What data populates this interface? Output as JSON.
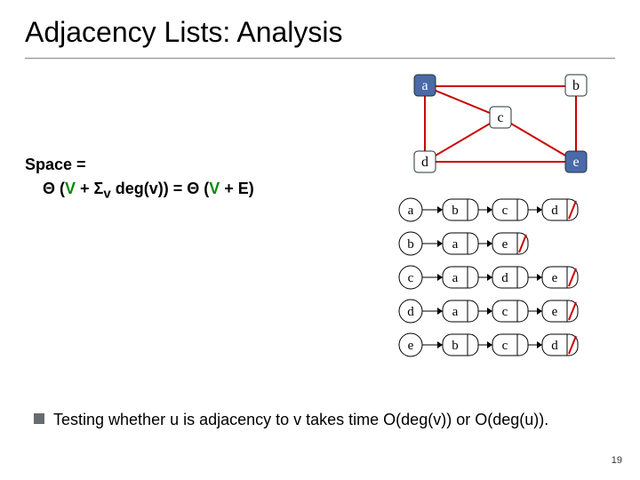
{
  "title": "Adjacency Lists: Analysis",
  "formula": {
    "line1": "Space =",
    "theta": "Θ",
    "open": " (",
    "V": "V",
    "plus": " + ",
    "sigma": "Σ",
    "sub_v": "v",
    "degv": " deg(v)) = ",
    "V2": "V",
    "plusE": " + E)"
  },
  "graph": {
    "nodes": [
      "a",
      "b",
      "c",
      "d",
      "e"
    ]
  },
  "adjacency": [
    {
      "head": "a",
      "list": [
        "b",
        "c",
        "d"
      ]
    },
    {
      "head": "b",
      "list": [
        "a",
        "e"
      ]
    },
    {
      "head": "c",
      "list": [
        "a",
        "d",
        "e"
      ]
    },
    {
      "head": "d",
      "list": [
        "a",
        "c",
        "e"
      ]
    },
    {
      "head": "e",
      "list": [
        "b",
        "c",
        "d"
      ]
    }
  ],
  "bullet": "Testing whether u is adjacency to v takes time O(deg(v)) or O(deg(u)).",
  "page_number": "19",
  "chart_data": {
    "type": "diagram",
    "description": "Undirected graph with 5 vertices and its adjacency-list representation",
    "vertices": [
      "a",
      "b",
      "c",
      "d",
      "e"
    ],
    "edges": [
      [
        "a",
        "b"
      ],
      [
        "a",
        "c"
      ],
      [
        "a",
        "d"
      ],
      [
        "b",
        "e"
      ],
      [
        "c",
        "d"
      ],
      [
        "c",
        "e"
      ],
      [
        "d",
        "e"
      ]
    ],
    "adjacency_lists": {
      "a": [
        "b",
        "c",
        "d"
      ],
      "b": [
        "a",
        "e"
      ],
      "c": [
        "a",
        "d",
        "e"
      ],
      "d": [
        "a",
        "c",
        "e"
      ],
      "e": [
        "b",
        "c",
        "d"
      ]
    },
    "space_formula": "Θ(V + Σ_v deg(v)) = Θ(V + E)"
  }
}
